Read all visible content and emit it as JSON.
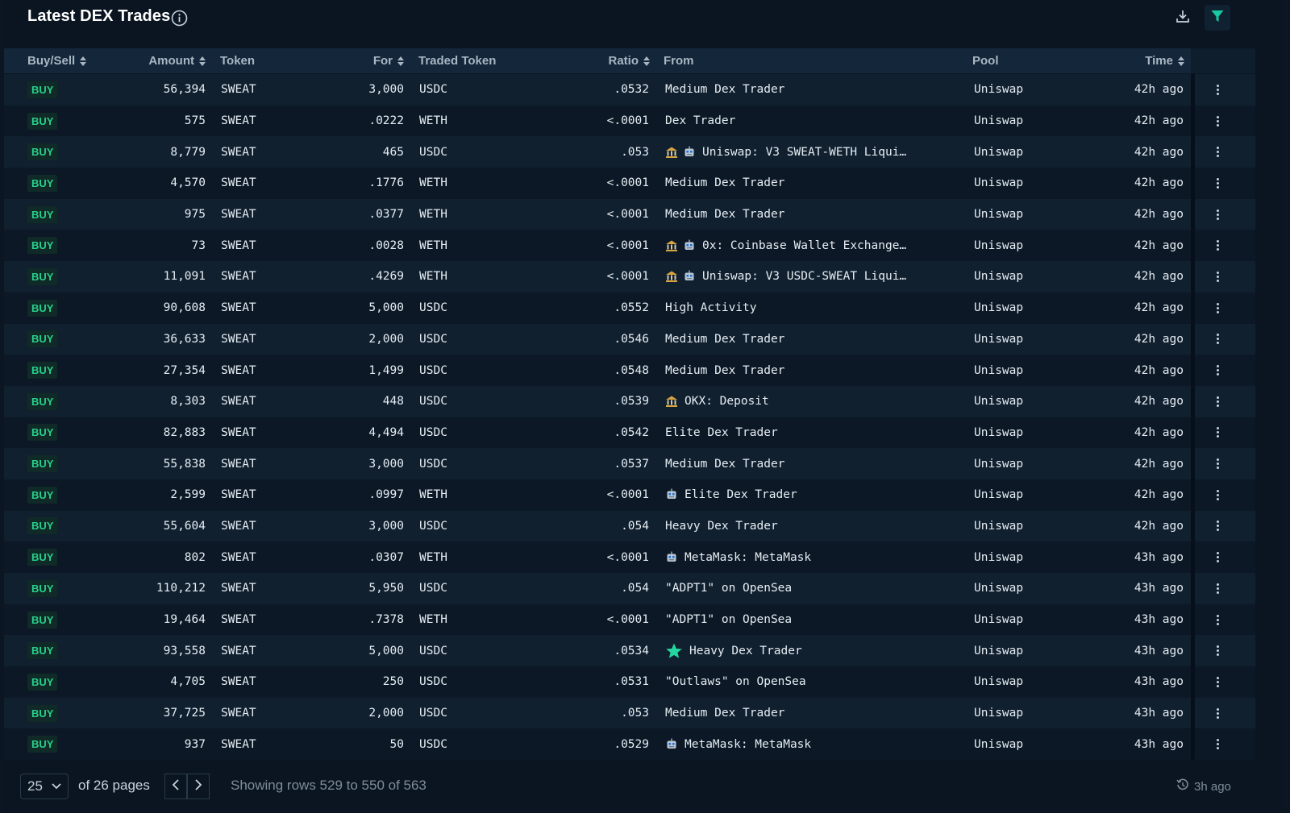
{
  "header": {
    "title": "Latest DEX Trades"
  },
  "columns": {
    "buy_sell": "Buy/Sell",
    "amount": "Amount",
    "token": "Token",
    "for": "For",
    "traded_token": "Traded Token",
    "ratio": "Ratio",
    "from": "From",
    "pool": "Pool",
    "time": "Time"
  },
  "rows": [
    {
      "side": "BUY",
      "amount": "56,394",
      "token": "SWEAT",
      "for": "3,000",
      "traded": "USDC",
      "ratio": ".0532",
      "icons": [],
      "from": "Medium Dex Trader",
      "pool": "Uniswap",
      "time": "42h ago"
    },
    {
      "side": "BUY",
      "amount": "575",
      "token": "SWEAT",
      "for": ".0222",
      "traded": "WETH",
      "ratio": "<.0001",
      "icons": [],
      "from": "Dex Trader",
      "pool": "Uniswap",
      "time": "42h ago"
    },
    {
      "side": "BUY",
      "amount": "8,779",
      "token": "SWEAT",
      "for": "465",
      "traded": "USDC",
      "ratio": ".053",
      "icons": [
        "bank",
        "robot"
      ],
      "from": "Uniswap: V3 SWEAT-WETH Liqui…",
      "pool": "Uniswap",
      "time": "42h ago"
    },
    {
      "side": "BUY",
      "amount": "4,570",
      "token": "SWEAT",
      "for": ".1776",
      "traded": "WETH",
      "ratio": "<.0001",
      "icons": [],
      "from": "Medium Dex Trader",
      "pool": "Uniswap",
      "time": "42h ago"
    },
    {
      "side": "BUY",
      "amount": "975",
      "token": "SWEAT",
      "for": ".0377",
      "traded": "WETH",
      "ratio": "<.0001",
      "icons": [],
      "from": "Medium Dex Trader",
      "pool": "Uniswap",
      "time": "42h ago"
    },
    {
      "side": "BUY",
      "amount": "73",
      "token": "SWEAT",
      "for": ".0028",
      "traded": "WETH",
      "ratio": "<.0001",
      "icons": [
        "bank",
        "robot"
      ],
      "from": "0x: Coinbase Wallet Exchange…",
      "pool": "Uniswap",
      "time": "42h ago"
    },
    {
      "side": "BUY",
      "amount": "11,091",
      "token": "SWEAT",
      "for": ".4269",
      "traded": "WETH",
      "ratio": "<.0001",
      "icons": [
        "bank",
        "robot"
      ],
      "from": "Uniswap: V3 USDC-SWEAT Liqui…",
      "pool": "Uniswap",
      "time": "42h ago"
    },
    {
      "side": "BUY",
      "amount": "90,608",
      "token": "SWEAT",
      "for": "5,000",
      "traded": "USDC",
      "ratio": ".0552",
      "icons": [],
      "from": "High Activity",
      "pool": "Uniswap",
      "time": "42h ago"
    },
    {
      "side": "BUY",
      "amount": "36,633",
      "token": "SWEAT",
      "for": "2,000",
      "traded": "USDC",
      "ratio": ".0546",
      "icons": [],
      "from": "Medium Dex Trader",
      "pool": "Uniswap",
      "time": "42h ago"
    },
    {
      "side": "BUY",
      "amount": "27,354",
      "token": "SWEAT",
      "for": "1,499",
      "traded": "USDC",
      "ratio": ".0548",
      "icons": [],
      "from": "Medium Dex Trader",
      "pool": "Uniswap",
      "time": "42h ago"
    },
    {
      "side": "BUY",
      "amount": "8,303",
      "token": "SWEAT",
      "for": "448",
      "traded": "USDC",
      "ratio": ".0539",
      "icons": [
        "bank"
      ],
      "from": "OKX: Deposit",
      "pool": "Uniswap",
      "time": "42h ago"
    },
    {
      "side": "BUY",
      "amount": "82,883",
      "token": "SWEAT",
      "for": "4,494",
      "traded": "USDC",
      "ratio": ".0542",
      "icons": [],
      "from": "Elite Dex Trader",
      "pool": "Uniswap",
      "time": "42h ago"
    },
    {
      "side": "BUY",
      "amount": "55,838",
      "token": "SWEAT",
      "for": "3,000",
      "traded": "USDC",
      "ratio": ".0537",
      "icons": [],
      "from": "Medium Dex Trader",
      "pool": "Uniswap",
      "time": "42h ago"
    },
    {
      "side": "BUY",
      "amount": "2,599",
      "token": "SWEAT",
      "for": ".0997",
      "traded": "WETH",
      "ratio": "<.0001",
      "icons": [
        "robot"
      ],
      "from": "Elite Dex Trader",
      "pool": "Uniswap",
      "time": "42h ago"
    },
    {
      "side": "BUY",
      "amount": "55,604",
      "token": "SWEAT",
      "for": "3,000",
      "traded": "USDC",
      "ratio": ".054",
      "icons": [],
      "from": "Heavy Dex Trader",
      "pool": "Uniswap",
      "time": "42h ago"
    },
    {
      "side": "BUY",
      "amount": "802",
      "token": "SWEAT",
      "for": ".0307",
      "traded": "WETH",
      "ratio": "<.0001",
      "icons": [
        "robot"
      ],
      "from": "MetaMask: MetaMask",
      "pool": "Uniswap",
      "time": "43h ago"
    },
    {
      "side": "BUY",
      "amount": "110,212",
      "token": "SWEAT",
      "for": "5,950",
      "traded": "USDC",
      "ratio": ".054",
      "icons": [],
      "from": "\"ADPT1\" on OpenSea",
      "pool": "Uniswap",
      "time": "43h ago"
    },
    {
      "side": "BUY",
      "amount": "19,464",
      "token": "SWEAT",
      "for": ".7378",
      "traded": "WETH",
      "ratio": "<.0001",
      "icons": [],
      "from": "\"ADPT1\" on OpenSea",
      "pool": "Uniswap",
      "time": "43h ago"
    },
    {
      "side": "BUY",
      "amount": "93,558",
      "token": "SWEAT",
      "for": "5,000",
      "traded": "USDC",
      "ratio": ".0534",
      "icons": [
        "star"
      ],
      "from": "Heavy Dex Trader",
      "pool": "Uniswap",
      "time": "43h ago"
    },
    {
      "side": "BUY",
      "amount": "4,705",
      "token": "SWEAT",
      "for": "250",
      "traded": "USDC",
      "ratio": ".0531",
      "icons": [],
      "from": "\"Outlaws\" on OpenSea",
      "pool": "Uniswap",
      "time": "43h ago"
    },
    {
      "side": "BUY",
      "amount": "37,725",
      "token": "SWEAT",
      "for": "2,000",
      "traded": "USDC",
      "ratio": ".053",
      "icons": [],
      "from": "Medium Dex Trader",
      "pool": "Uniswap",
      "time": "43h ago"
    },
    {
      "side": "BUY",
      "amount": "937",
      "token": "SWEAT",
      "for": "50",
      "traded": "USDC",
      "ratio": ".0529",
      "icons": [
        "robot"
      ],
      "from": "MetaMask: MetaMask",
      "pool": "Uniswap",
      "time": "43h ago"
    }
  ],
  "footer": {
    "page_size": "25",
    "of_pages": "of 26 pages",
    "showing": "Showing rows 529 to 550 of 563",
    "updated": "3h ago"
  },
  "colors": {
    "buy_text": "#27d08b",
    "buy_bg": "#102a27",
    "filter_accent": "#19c9a0",
    "star": "#26d6a0"
  }
}
